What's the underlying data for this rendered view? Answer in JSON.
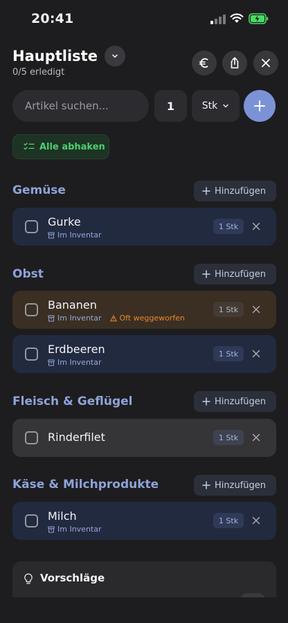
{
  "status_bar": {
    "time": "20:41"
  },
  "header": {
    "title": "Hauptliste",
    "progress": "0/5 erledigt"
  },
  "add_row": {
    "search_placeholder": "Artikel suchen...",
    "quantity": "1",
    "unit": "Stk"
  },
  "check_all_label": "Alle abhaken",
  "add_label": "Hinzufügen",
  "sections": [
    {
      "title": "Gemüse",
      "items": [
        {
          "name": "Gurke",
          "inventory": "Im Inventar",
          "qty": "1 Stk"
        }
      ]
    },
    {
      "title": "Obst",
      "items": [
        {
          "name": "Bananen",
          "inventory": "Im Inventar",
          "warning": "Oft weggeworfen",
          "qty": "1 Stk"
        },
        {
          "name": "Erdbeeren",
          "inventory": "Im Inventar",
          "qty": "1 Stk"
        }
      ]
    },
    {
      "title": "Fleisch & Geflügel",
      "items": [
        {
          "name": "Rinderfilet",
          "qty": "1 Stk"
        }
      ]
    },
    {
      "title": "Käse & Milchprodukte",
      "items": [
        {
          "name": "Milch",
          "inventory": "Im Inventar",
          "qty": "1 Stk"
        }
      ]
    }
  ],
  "suggestions": {
    "title": "Vorschläge"
  },
  "colors": {
    "accent": "#7b93d6",
    "section_title": "#8ea3d9",
    "success": "#4fce71",
    "warning": "#e9862e",
    "battery": "#4cd964"
  },
  "icons": [
    "chevron-down-icon",
    "euro-icon",
    "share-icon",
    "close-icon",
    "plus-icon",
    "checklist-icon",
    "archive-icon",
    "warning-icon",
    "lightbulb-icon"
  ]
}
